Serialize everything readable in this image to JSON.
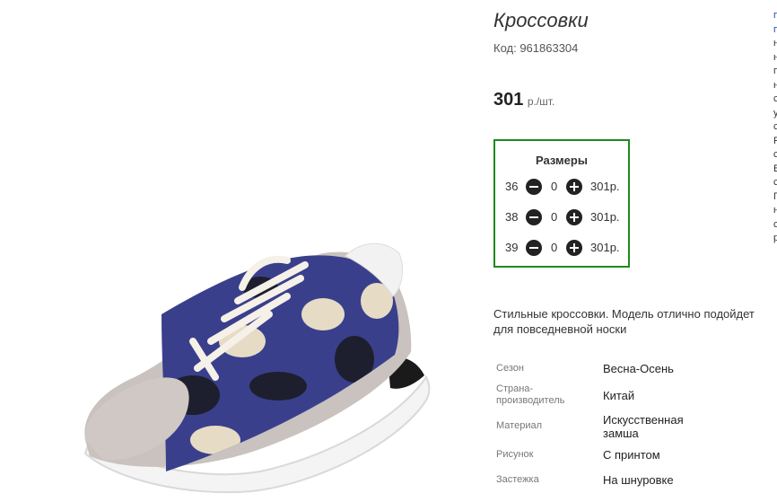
{
  "product": {
    "title": "Кроссовки",
    "code_label": "Код: 961863304",
    "price": "301",
    "price_unit": "р./шт."
  },
  "sizes": {
    "title": "Размеры",
    "rows": [
      {
        "size": "36",
        "qty": "0",
        "price": "301р."
      },
      {
        "size": "38",
        "qty": "0",
        "price": "301р."
      },
      {
        "size": "39",
        "qty": "0",
        "price": "301р."
      }
    ]
  },
  "description": {
    "line1": "Стильные кроссовки. Модель отлично подойдет",
    "line2": "для повседневной носки"
  },
  "specs": [
    {
      "label": "Сезон",
      "value": "Весна-Осень"
    },
    {
      "label": "Страна-производитель",
      "value": "Китай"
    },
    {
      "label": "Материал",
      "value": "Искусственная замша"
    },
    {
      "label": "Рисунок",
      "value": "С принтом"
    },
    {
      "label": "Застежка",
      "value": "На шнуровке"
    }
  ],
  "side_letters": [
    "п",
    "п",
    "н",
    "н",
    "п",
    "н",
    "с",
    "у",
    "с",
    "Р",
    "с",
    "Б",
    "с",
    "П",
    "н",
    "с",
    "р"
  ],
  "colors": {
    "accent_border": "#1e8a1e",
    "shoe_suede": "#c9c2bf",
    "camo_navy": "#3a3f8c",
    "camo_black": "#1e1f2e",
    "camo_beige": "#e6dcc5",
    "sole": "#ffffff"
  },
  "icons": [
    "minus-circle-icon",
    "plus-circle-icon"
  ]
}
